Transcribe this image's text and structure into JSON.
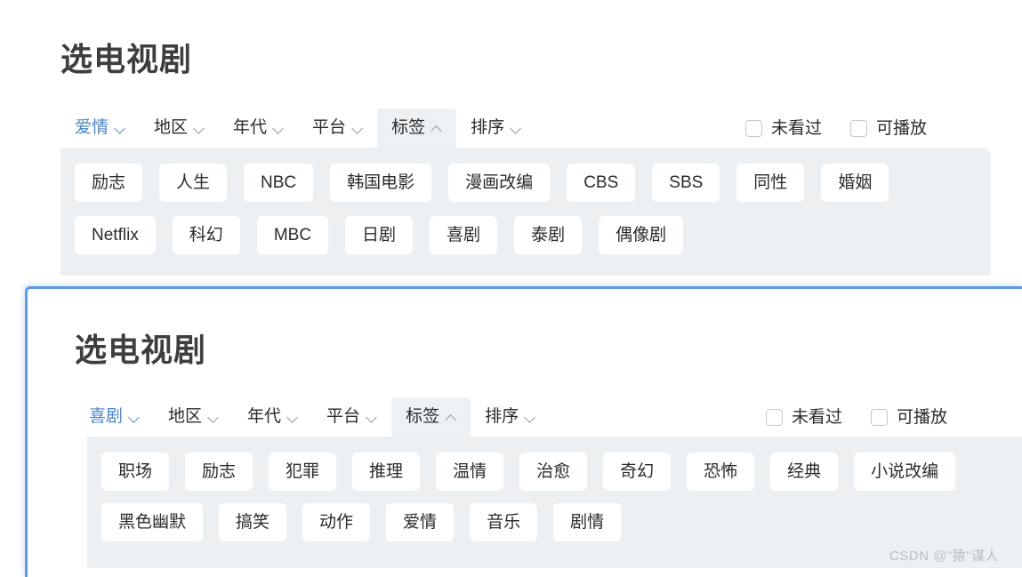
{
  "colors": {
    "accent_blue": "#4a86c8",
    "panel_border_blue": "#5f9aea",
    "drawer_bg": "#edf0f2",
    "chip_bg": "#ffffff",
    "title_text": "#3c3f41",
    "body_text": "#2b2b2b",
    "watermark_text": "#b9bfc5"
  },
  "watermark": {
    "text": "CSDN @\"猿\"谋人"
  },
  "panel_back": {
    "title": "选电视剧",
    "filters": [
      {
        "label": "爱情",
        "icon": "chevron-down-icon",
        "state": "category-selected"
      },
      {
        "label": "地区",
        "icon": "chevron-down-icon",
        "state": "default"
      },
      {
        "label": "年代",
        "icon": "chevron-down-icon",
        "state": "default"
      },
      {
        "label": "平台",
        "icon": "chevron-down-icon",
        "state": "default"
      },
      {
        "label": "标签",
        "icon": "chevron-up-icon",
        "state": "open"
      },
      {
        "label": "排序",
        "icon": "chevron-down-icon",
        "state": "default"
      }
    ],
    "checkboxes": [
      {
        "label": "未看过",
        "checked": false
      },
      {
        "label": "可播放",
        "checked": false
      }
    ],
    "tag_rows": [
      [
        "励志",
        "人生",
        "NBC",
        "韩国电影",
        "漫画改编",
        "CBS",
        "SBS",
        "同性",
        "婚姻"
      ],
      [
        "Netflix",
        "科幻",
        "MBC",
        "日剧",
        "喜剧",
        "泰剧",
        "偶像剧"
      ]
    ]
  },
  "panel_front": {
    "title": "选电视剧",
    "filters": [
      {
        "label": "喜剧",
        "icon": "chevron-down-icon",
        "state": "category-selected"
      },
      {
        "label": "地区",
        "icon": "chevron-down-icon",
        "state": "default"
      },
      {
        "label": "年代",
        "icon": "chevron-down-icon",
        "state": "default"
      },
      {
        "label": "平台",
        "icon": "chevron-down-icon",
        "state": "default"
      },
      {
        "label": "标签",
        "icon": "chevron-up-icon",
        "state": "open"
      },
      {
        "label": "排序",
        "icon": "chevron-down-icon",
        "state": "default"
      }
    ],
    "checkboxes": [
      {
        "label": "未看过",
        "checked": false
      },
      {
        "label": "可播放",
        "checked": false
      }
    ],
    "tag_rows": [
      [
        "职场",
        "励志",
        "犯罪",
        "推理",
        "温情",
        "治愈",
        "奇幻",
        "恐怖",
        "经典",
        "小说改编"
      ],
      [
        "黑色幽默",
        "搞笑",
        "动作",
        "爱情",
        "音乐",
        "剧情"
      ]
    ]
  }
}
